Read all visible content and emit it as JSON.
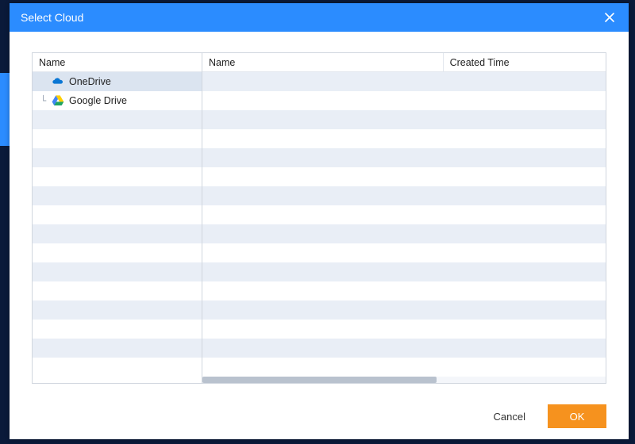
{
  "dialog": {
    "title": "Select Cloud"
  },
  "left_pane": {
    "header": "Name",
    "items": [
      {
        "label": "OneDrive",
        "icon": "onedrive",
        "selected": true
      },
      {
        "label": "Google Drive",
        "icon": "gdrive",
        "selected": false
      }
    ],
    "total_rows": 15
  },
  "right_pane": {
    "columns": [
      "Name",
      "Created Time"
    ],
    "total_rows": 15
  },
  "footer": {
    "cancel_label": "Cancel",
    "ok_label": "OK"
  },
  "colors": {
    "accent": "#2b8cff",
    "primary_button": "#f6921e"
  }
}
